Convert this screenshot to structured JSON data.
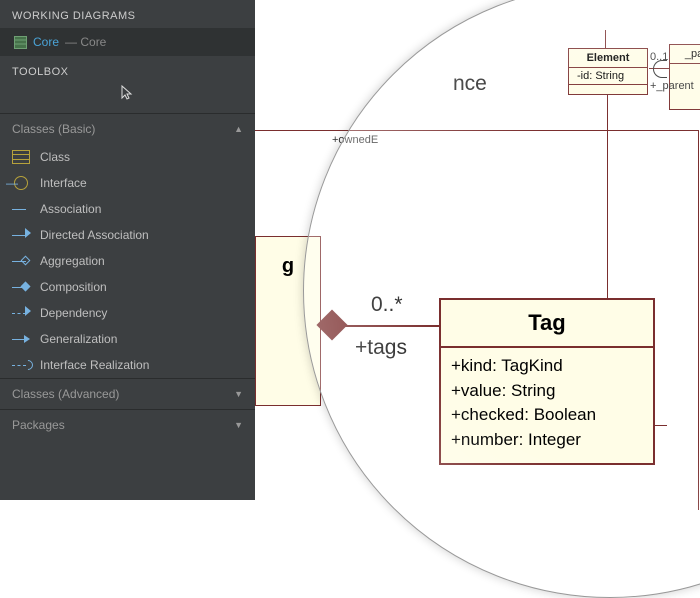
{
  "sidebar": {
    "working_title": "WORKING DIAGRAMS",
    "diagram_name": "Core",
    "diagram_sub": "— Core",
    "toolbox_title": "TOOLBOX",
    "groups": [
      {
        "label": "Classes (Basic)",
        "expanded": true
      },
      {
        "label": "Classes (Advanced)",
        "expanded": false
      },
      {
        "label": "Packages",
        "expanded": false
      }
    ],
    "tools": [
      {
        "label": "Class",
        "icon": "class"
      },
      {
        "label": "Interface",
        "icon": "interface"
      },
      {
        "label": "Association",
        "icon": "association"
      },
      {
        "label": "Directed Association",
        "icon": "directed-association"
      },
      {
        "label": "Aggregation",
        "icon": "aggregation"
      },
      {
        "label": "Composition",
        "icon": "composition"
      },
      {
        "label": "Dependency",
        "icon": "dependency"
      },
      {
        "label": "Generalization",
        "icon": "generalization"
      },
      {
        "label": "Interface Realization",
        "icon": "interface-realization"
      }
    ]
  },
  "canvas": {
    "element_box": {
      "name": "Element",
      "attr": "-id: String"
    },
    "parent_box": {
      "name": "_pare"
    },
    "parent_mult": "0..1",
    "parent_role": "+_parent",
    "owned_label": "+ownedE",
    "nce_fragment": "nce",
    "plus_fragment": "+",
    "left_box_label": "g",
    "tag_mult": "0..*",
    "tags_label": "+tags",
    "tag_box": {
      "name": "Tag",
      "attrs": [
        "+kind: TagKind",
        "+value: String",
        "+checked: Boolean",
        "+number: Integer"
      ]
    }
  }
}
